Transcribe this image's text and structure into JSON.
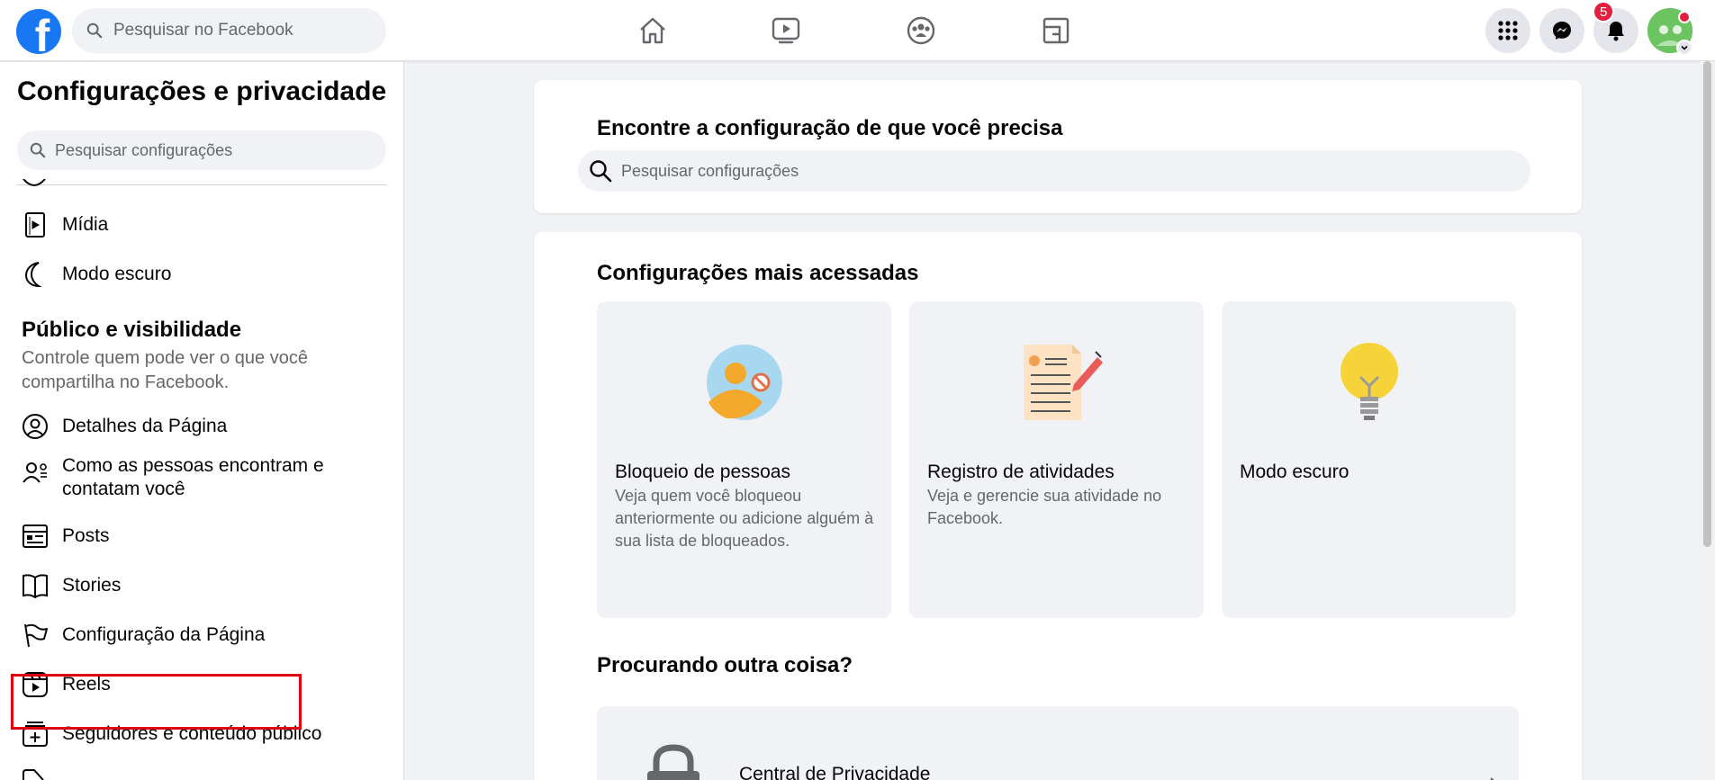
{
  "topbar": {
    "search_placeholder": "Pesquisar no Facebook",
    "notification_count": "5"
  },
  "sidebar": {
    "title": "Configurações e privacidade",
    "search_placeholder": "Pesquisar configurações",
    "items_top": [
      {
        "label": "Mídia",
        "icon": "media-icon"
      },
      {
        "label": "Modo escuro",
        "icon": "moon-icon"
      }
    ],
    "section": {
      "title": "Público e visibilidade",
      "description": "Controle quem pode ver o que você compartilha no Facebook."
    },
    "items": [
      {
        "label": "Detalhes da Página",
        "icon": "profile-icon"
      },
      {
        "label": "Como as pessoas encontram e contatam você",
        "icon": "person-settings-icon"
      },
      {
        "label": "Posts",
        "icon": "posts-icon"
      },
      {
        "label": "Stories",
        "icon": "book-icon"
      },
      {
        "label": "Configuração da Página",
        "icon": "flag-icon"
      },
      {
        "label": "Reels",
        "icon": "reels-icon"
      },
      {
        "label": "Seguidores e conteúdo público",
        "icon": "plus-box-icon"
      }
    ]
  },
  "main": {
    "find_heading": "Encontre a configuração de que você precisa",
    "search_placeholder": "Pesquisar configurações",
    "most_used_heading": "Configurações mais acessadas",
    "tiles": [
      {
        "title": "Bloqueio de pessoas",
        "description": "Veja quem você bloqueou anteriormente ou adicione alguém à sua lista de bloqueados."
      },
      {
        "title": "Registro de atividades",
        "description": "Veja e gerencie sua atividade no Facebook."
      },
      {
        "title": "Modo escuro",
        "description": ""
      }
    ],
    "other_heading": "Procurando outra coisa?",
    "privacy_center_label": "Central de Privacidade"
  },
  "colors": {
    "brand": "#1877f2",
    "highlight_box": "#e0000f",
    "badge": "#e41e3f"
  }
}
